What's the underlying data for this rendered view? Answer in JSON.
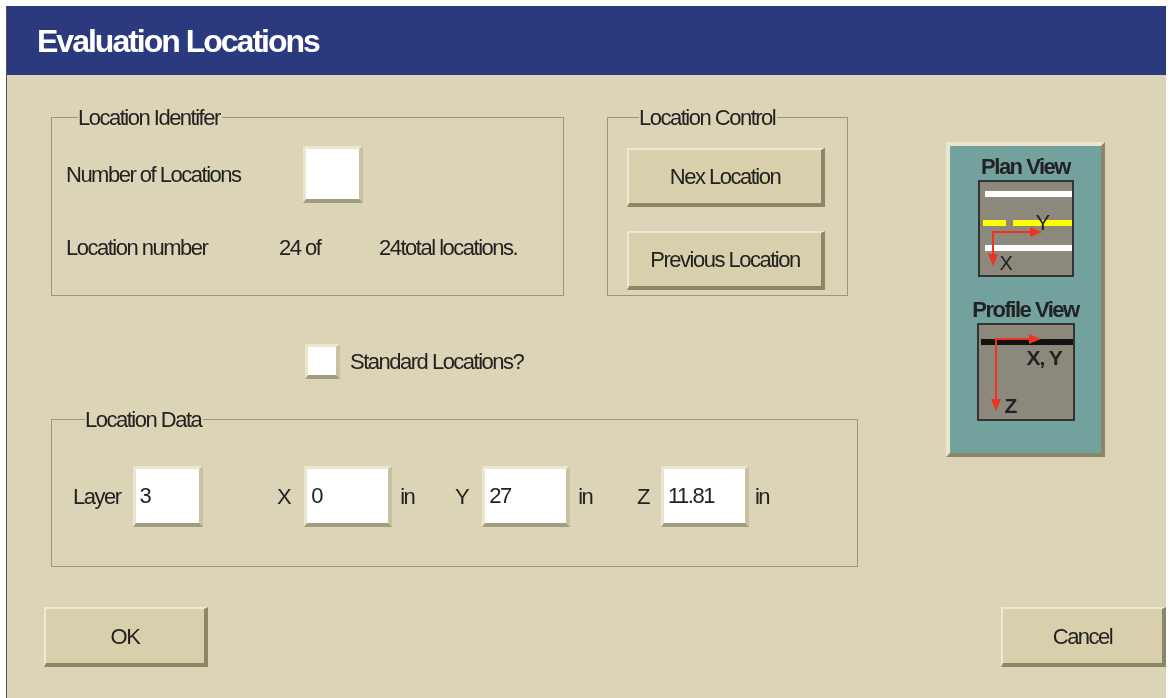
{
  "window": {
    "title": "Evaluation Locations"
  },
  "location_identifier": {
    "legend": "Location Identifer",
    "number_label": "Number of Locations",
    "location_number_label": "Location number",
    "current": "24 of",
    "total": "24total locations."
  },
  "location_control": {
    "legend": "Location Control",
    "buttons": [
      "Nex Location",
      "Previous Location"
    ]
  },
  "standard_locations": {
    "label": "Standard Locations?",
    "checked": false
  },
  "location_data": {
    "legend": "Location Data",
    "fields": [
      {
        "label": "Layer",
        "value": "3"
      },
      {
        "label": "X",
        "value": "0",
        "unit": "in"
      },
      {
        "label": "Y",
        "value": "27",
        "unit": "in"
      },
      {
        "label": "Z",
        "value": "11.81",
        "unit": "in"
      }
    ]
  },
  "axes_legend": {
    "plan_title": "Plan View",
    "plan_axes": [
      "Y",
      "X"
    ],
    "profile_title": "Profile View",
    "profile_axes": [
      "X, Y",
      "Z"
    ]
  },
  "buttons": [
    "OK",
    "Cancel"
  ]
}
